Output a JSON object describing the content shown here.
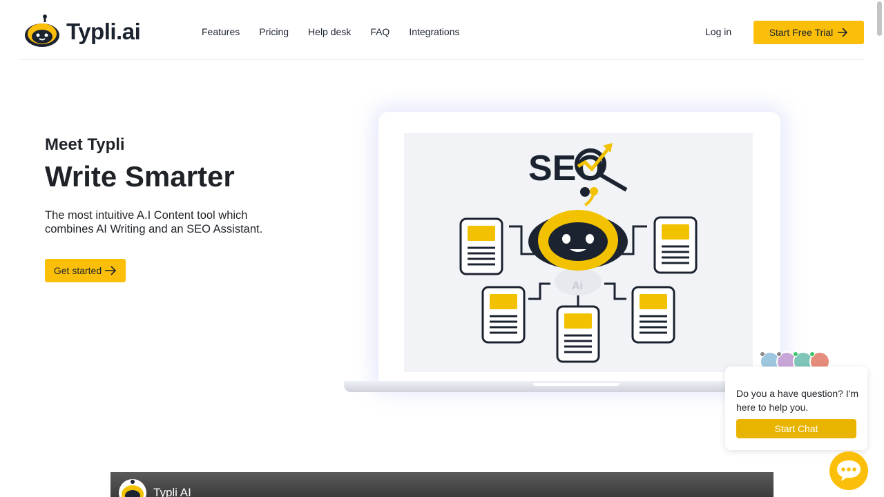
{
  "brand": {
    "name": "Typli.ai",
    "accent": "#fbbf0a",
    "dark": "#1c2330"
  },
  "nav": {
    "items": [
      "Features",
      "Pricing",
      "Help desk",
      "FAQ",
      "Integrations"
    ],
    "login_label": "Log in",
    "trial_label": "Start Free Trial"
  },
  "hero": {
    "eyebrow": "Meet Typli",
    "headline": "Write Smarter",
    "description": "The most intuitive A.I Content tool which combines AI Writing and an SEO Assistant.",
    "cta_label": "Get started"
  },
  "illustration": {
    "title": "SEO",
    "robot_label": "Ai"
  },
  "chat": {
    "message": "Do you a have question? I'm here to help you.",
    "button_label": "Start Chat"
  },
  "video": {
    "title": "Typli AI"
  }
}
